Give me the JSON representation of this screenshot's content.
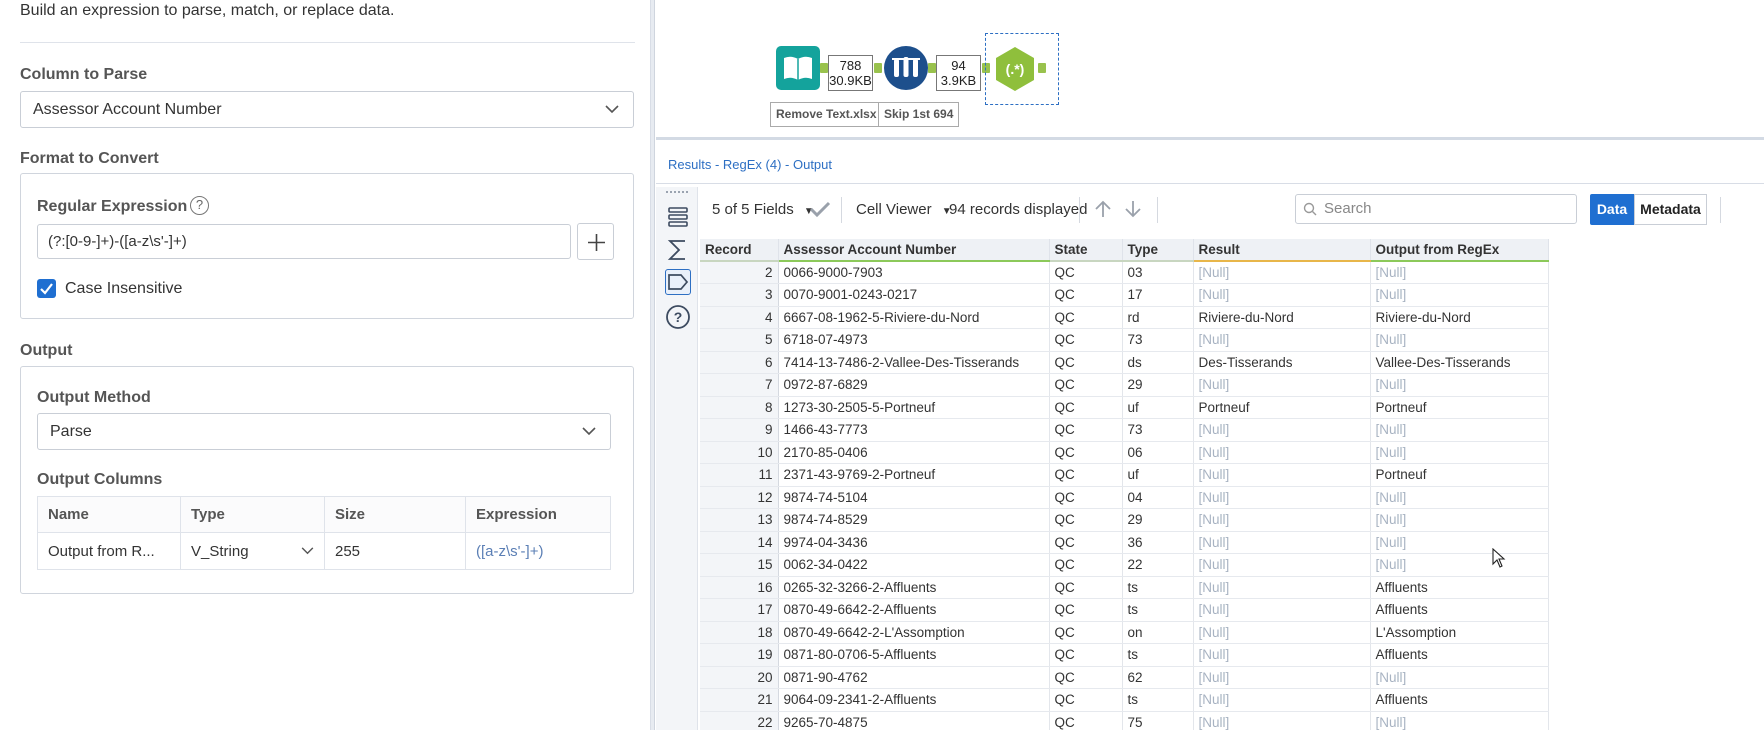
{
  "config": {
    "subtitle": "Build an expression to parse, match, or replace data.",
    "column_to_parse_label": "Column to Parse",
    "column_to_parse_value": "Assessor Account Number",
    "format_label": "Format to Convert",
    "regex_label": "Regular Expression",
    "regex_value": "(?:[0-9-]+)-([a-z\\s'-]+)",
    "case_insensitive_label": "Case Insensitive",
    "output_label": "Output",
    "output_method_label": "Output Method",
    "output_method_value": "Parse",
    "output_columns_label": "Output Columns",
    "columns_headers": {
      "name": "Name",
      "type": "Type",
      "size": "Size",
      "expression": "Expression"
    },
    "columns_row": {
      "name": "Output from R...",
      "type": "V_String",
      "size": "255",
      "expression": "([a-z\\s'-]+)"
    }
  },
  "canvas": {
    "conn1": {
      "records": "788",
      "size": "30.9KB"
    },
    "conn2": {
      "records": "94",
      "size": "3.9KB"
    },
    "input_label": "Remove Text.xlsx",
    "sample_label": "Skip 1st 694",
    "regex_glyph": "(.*)",
    "colors": {
      "input_tool": "#14a39c",
      "sample_tool": "#1d4f8c",
      "regex_tool": "#8fbf3c",
      "anchor": "#99c24d"
    },
    "icons": [
      "book-icon",
      "flasks-icon",
      "regex-icon"
    ]
  },
  "results": {
    "title": "Results - RegEx (4) - Output",
    "fields_label": "5 of 5 Fields",
    "cell_viewer_label": "Cell Viewer",
    "records_label": "94 records displayed",
    "search_placeholder": "Search",
    "data_btn": "Data",
    "metadata_btn": "Metadata",
    "headers": [
      "Record",
      "Assessor Account Number",
      "State",
      "Type",
      "Result",
      "Output from RegEx"
    ],
    "rows": [
      [
        "2",
        "0066-9000-7903",
        "QC",
        "03",
        "[Null]",
        "[Null]"
      ],
      [
        "3",
        "0070-9001-0243-0217",
        "QC",
        "17",
        "[Null]",
        "[Null]"
      ],
      [
        "4",
        "6667-08-1962-5-Riviere-du-Nord",
        "QC",
        "rd",
        "Riviere-du-Nord",
        "Riviere-du-Nord"
      ],
      [
        "5",
        "6718-07-4973",
        "QC",
        "73",
        "[Null]",
        "[Null]"
      ],
      [
        "6",
        "7414-13-7486-2-Vallee-Des-Tisserands",
        "QC",
        "ds",
        "Des-Tisserands",
        "Vallee-Des-Tisserands"
      ],
      [
        "7",
        "0972-87-6829",
        "QC",
        "29",
        "[Null]",
        "[Null]"
      ],
      [
        "8",
        "1273-30-2505-5-Portneuf",
        "QC",
        "uf",
        "Portneuf",
        "Portneuf"
      ],
      [
        "9",
        "1466-43-7773",
        "QC",
        "73",
        "[Null]",
        "[Null]"
      ],
      [
        "10",
        "2170-85-0406",
        "QC",
        "06",
        "[Null]",
        "[Null]"
      ],
      [
        "11",
        "2371-43-9769-2-Portneuf",
        "QC",
        "uf",
        "[Null]",
        "Portneuf"
      ],
      [
        "12",
        "9874-74-5104",
        "QC",
        "04",
        "[Null]",
        "[Null]"
      ],
      [
        "13",
        "9874-74-8529",
        "QC",
        "29",
        "[Null]",
        "[Null]"
      ],
      [
        "14",
        "9974-04-3436",
        "QC",
        "36",
        "[Null]",
        "[Null]"
      ],
      [
        "15",
        "0062-34-0422",
        "QC",
        "22",
        "[Null]",
        "[Null]"
      ],
      [
        "16",
        "0265-32-3266-2-Affluents",
        "QC",
        "ts",
        "[Null]",
        "Affluents"
      ],
      [
        "17",
        "0870-49-6642-2-Affluents",
        "QC",
        "ts",
        "[Null]",
        "Affluents"
      ],
      [
        "18",
        "0870-49-6642-2-L'Assomption",
        "QC",
        "on",
        "[Null]",
        "L'Assomption"
      ],
      [
        "19",
        "0871-80-0706-5-Affluents",
        "QC",
        "ts",
        "[Null]",
        "Affluents"
      ],
      [
        "20",
        "0871-90-4762",
        "QC",
        "62",
        "[Null]",
        "[Null]"
      ],
      [
        "21",
        "9064-09-2341-2-Affluents",
        "QC",
        "ts",
        "[Null]",
        "Affluents"
      ],
      [
        "22",
        "9265-70-4875",
        "QC",
        "75",
        "[Null]",
        "[Null]"
      ]
    ],
    "accent": "#1f6fd1"
  }
}
